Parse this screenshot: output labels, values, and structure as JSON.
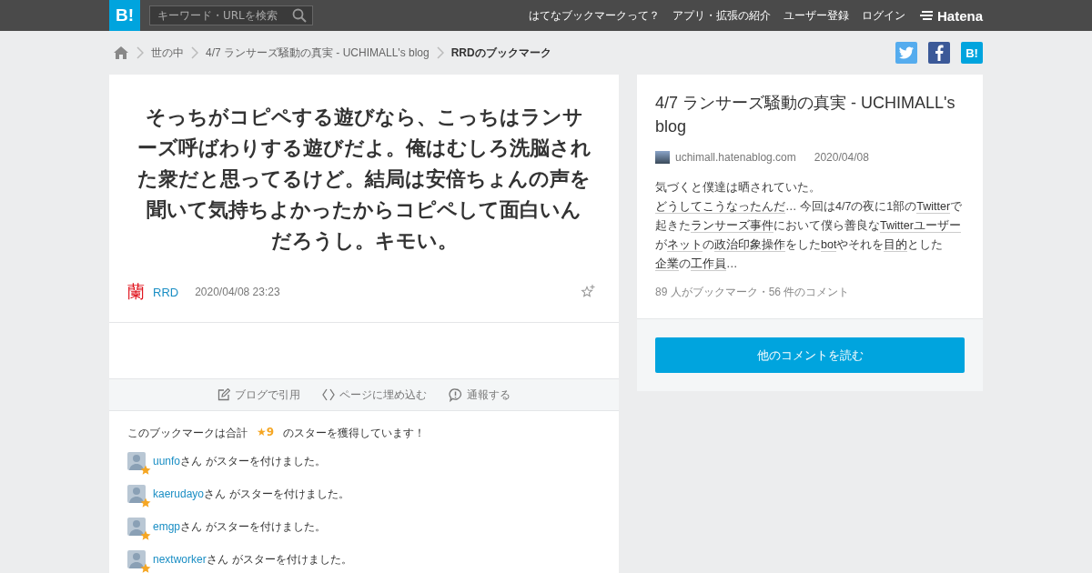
{
  "header": {
    "logo": "B!",
    "search": {
      "placeholder": "キーワード・URLを検索"
    },
    "nav": [
      "はてなブックマークって？",
      "アプリ・拡張の紹介",
      "ユーザー登録",
      "ログイン"
    ],
    "brand": "Hatena"
  },
  "breadcrumb": {
    "items": [
      "世の中",
      "4/7 ランサーズ騒動の真実 - UCHIMALL's blog"
    ],
    "current": "RRDのブックマーク"
  },
  "share": [
    {
      "kind": "twitter"
    },
    {
      "kind": "facebook"
    },
    {
      "kind": "hatena",
      "label": "B!"
    }
  ],
  "comment": {
    "text": "そっちがコピペする遊びなら、こっちはランサーズ呼ばわりする遊びだよ。俺はむしろ洗脳された衆だと思ってるけど。結局は安倍ちょんの声を聞いて気持ちよかったからコピペして面白いんだろうし。キモい。",
    "avatar_char": "蘭",
    "user": "RRD",
    "datetime": "2020/04/08 23:23"
  },
  "actions": [
    {
      "kind": "quote",
      "label": "ブログで引用"
    },
    {
      "kind": "embed",
      "label": "ページに埋め込む"
    },
    {
      "kind": "report",
      "label": "通報する"
    }
  ],
  "stars": {
    "prefix": "このブックマークは合計",
    "count": "★9",
    "suffix": "のスターを獲得しています！",
    "users": [
      {
        "name": "uunfo",
        "text": "さん がスターを付けました。"
      },
      {
        "name": "kaerudayo",
        "text": "さん がスターを付けました。"
      },
      {
        "name": "emgp",
        "text": "さん がスターを付けました。"
      },
      {
        "name": "nextworker",
        "text": "さん がスターを付けました。"
      }
    ]
  },
  "entry": {
    "title": "4/7 ランサーズ騒動の真実 - UCHIMALL's blog",
    "domain": "uchimall.hatenablog.com",
    "date": "2020/04/08",
    "summary": [
      {
        "text": "気づくと僕達は晒されていた。 ",
        "link": false
      },
      {
        "text": "どうしてこうなったんだ",
        "link": true
      },
      {
        "text": "… 今回は4/7の夜に1部の",
        "link": false
      },
      {
        "text": "Twitter",
        "link": true
      },
      {
        "text": "で起きた",
        "link": false
      },
      {
        "text": "ランサーズ事件",
        "link": true
      },
      {
        "text": "において僕ら善良な",
        "link": false
      },
      {
        "text": "Twitterユーザー",
        "link": true
      },
      {
        "text": "が",
        "link": false
      },
      {
        "text": "ネット",
        "link": true
      },
      {
        "text": "の",
        "link": false
      },
      {
        "text": "政治印象操作",
        "link": true
      },
      {
        "text": "をした",
        "link": false
      },
      {
        "text": "bot",
        "link": true
      },
      {
        "text": "やそれを",
        "link": false
      },
      {
        "text": "目的",
        "link": true
      },
      {
        "text": "とした",
        "link": false
      },
      {
        "text": "企業",
        "link": true
      },
      {
        "text": "の",
        "link": false
      },
      {
        "text": "工作員",
        "link": true
      },
      {
        "text": "…",
        "link": false
      }
    ],
    "counts": "89 人がブックマーク・56 件のコメント",
    "button": "他のコメントを読む"
  }
}
